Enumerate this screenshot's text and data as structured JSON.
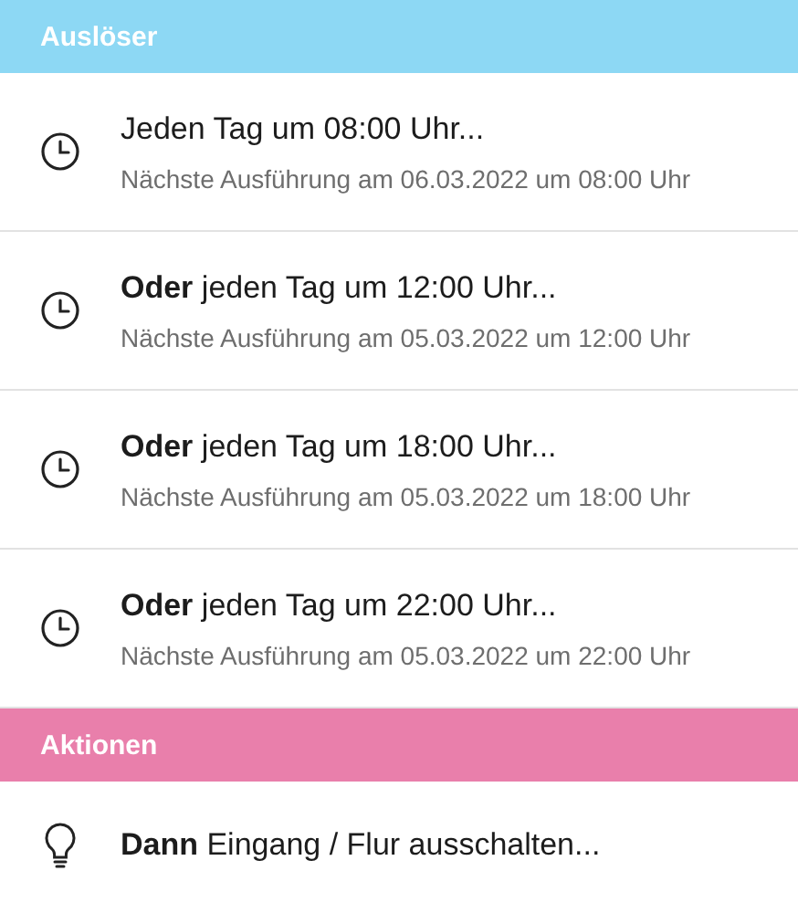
{
  "sections": [
    {
      "title": "Auslöser",
      "color": "#8dd8f4",
      "items": [
        {
          "kind": "clock",
          "title": "Jeden Tag um 08:00 Uhr...",
          "subtitle": "Nächste Ausführung am 06.03.2022 um 08:00 Uhr"
        },
        {
          "kind": "clock",
          "title": "**Oder** jeden Tag um 12:00 Uhr...",
          "subtitle": "Nächste Ausführung am 05.03.2022 um 12:00 Uhr"
        },
        {
          "kind": "clock",
          "title": "**Oder** jeden Tag um 18:00 Uhr...",
          "subtitle": "Nächste Ausführung am 05.03.2022 um 18:00 Uhr"
        },
        {
          "kind": "clock",
          "title": "**Oder** jeden Tag um 22:00 Uhr...",
          "subtitle": "Nächste Ausführung am 05.03.2022 um 22:00 Uhr"
        }
      ]
    },
    {
      "title": "Aktionen",
      "color": "#e97fab",
      "items": [
        {
          "kind": "bulb",
          "title": "**Dann** Eingang / Flur ausschalten..."
        }
      ]
    }
  ]
}
